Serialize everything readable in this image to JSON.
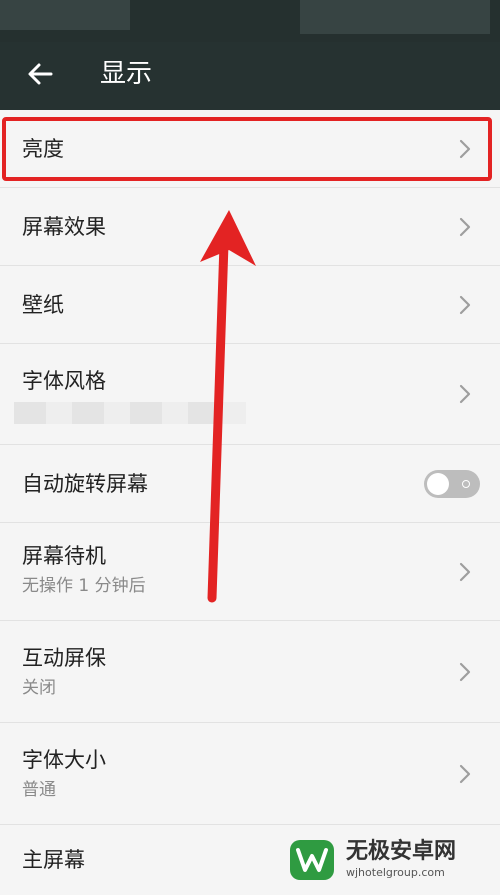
{
  "header": {
    "back_icon": "arrow-left-icon",
    "title": "显示"
  },
  "settings": {
    "brightness": {
      "title": "亮度"
    },
    "screen_effect": {
      "title": "屏幕效果"
    },
    "wallpaper": {
      "title": "壁纸"
    },
    "font_style": {
      "title": "字体风格"
    },
    "auto_rotate": {
      "title": "自动旋转屏幕",
      "enabled": false
    },
    "screen_timeout": {
      "title": "屏幕待机",
      "value": "无操作 1 分钟后"
    },
    "interactive_screensaver": {
      "title": "互动屏保",
      "value": "关闭"
    },
    "font_size": {
      "title": "字体大小",
      "value": "普通"
    },
    "home_screen": {
      "title": "主屏幕"
    }
  },
  "annotation": {
    "color": "#e32323"
  },
  "watermark": {
    "name": "无极安卓网",
    "url": "wjhotelgroup.com"
  },
  "colors": {
    "app_bar": "#263231",
    "background": "#f5f5f5"
  }
}
